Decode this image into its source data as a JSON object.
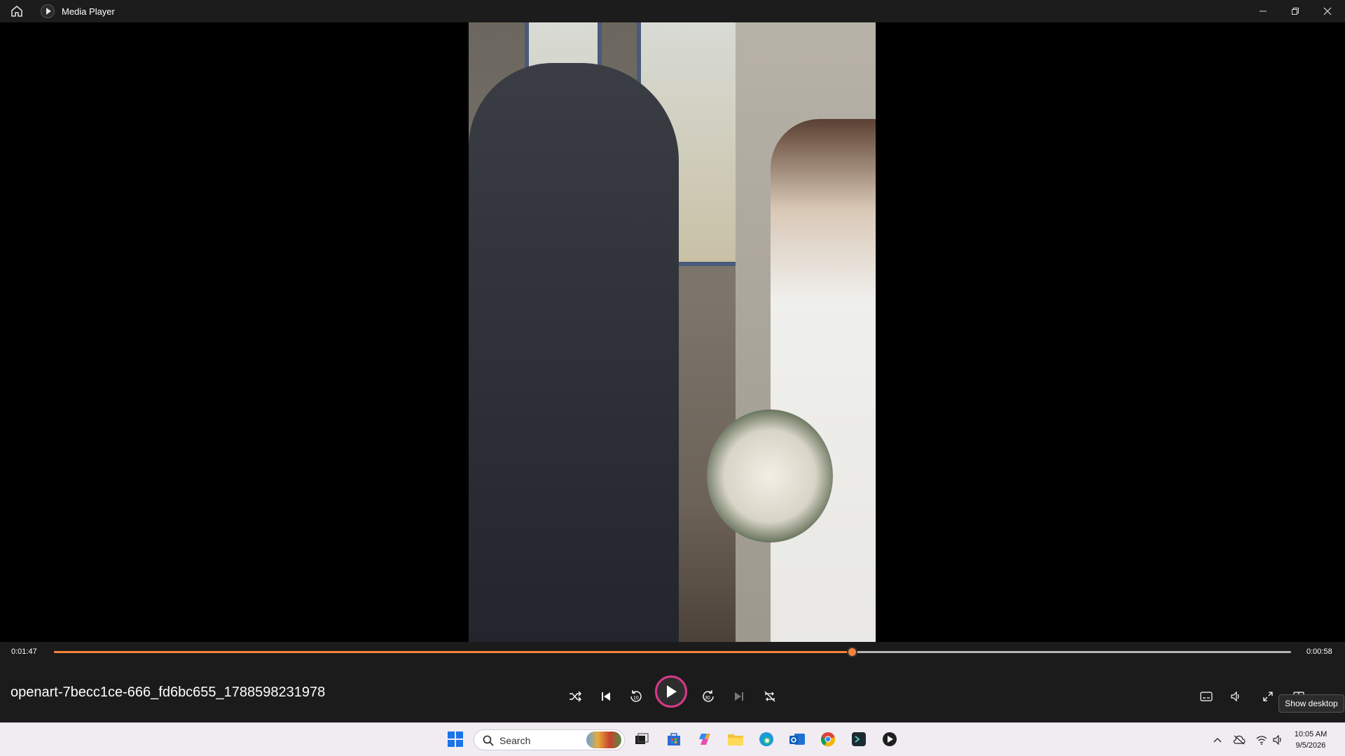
{
  "app": {
    "title": "Media Player"
  },
  "player": {
    "elapsed": "0:01:47",
    "remaining": "0:00:58",
    "progress_fraction": 0.645,
    "filename": "openart-7becc1ce-666_fd6bc655_1788598231978",
    "accent_color": "#f5823b",
    "play_ring_color": "#d9388a"
  },
  "tooltip": {
    "text": "Show desktop"
  },
  "taskbar": {
    "search_placeholder": "Search",
    "clock_time": "10:05 AM",
    "clock_date": "9/5/2026"
  }
}
